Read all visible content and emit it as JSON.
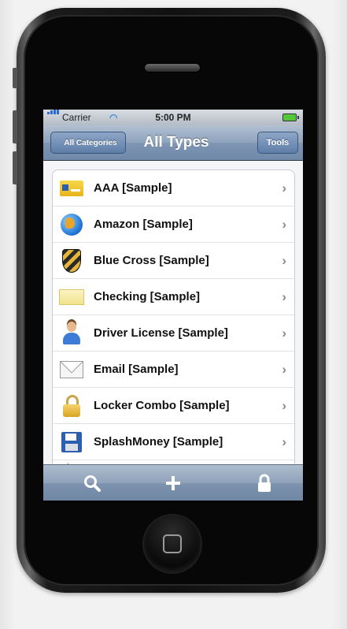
{
  "status_bar": {
    "carrier": "Carrier",
    "time": "5:00 PM"
  },
  "nav": {
    "back_label": "All Categories",
    "title": "All Types",
    "tools_label": "Tools"
  },
  "list": {
    "items": [
      {
        "label": "AAA [Sample]",
        "icon": "id-card-icon"
      },
      {
        "label": "Amazon [Sample]",
        "icon": "globe-icon"
      },
      {
        "label": "Blue Cross [Sample]",
        "icon": "shield-icon"
      },
      {
        "label": "Checking [Sample]",
        "icon": "check-icon"
      },
      {
        "label": "Driver License [Sample]",
        "icon": "person-icon"
      },
      {
        "label": "Email [Sample]",
        "icon": "mail-icon"
      },
      {
        "label": "Locker Combo [Sample]",
        "icon": "padlock-icon"
      },
      {
        "label": "SplashMoney [Sample]",
        "icon": "floppy-icon"
      }
    ],
    "chevron": "›"
  },
  "tab_bar": {
    "items": [
      {
        "name": "search-icon",
        "glyph": "⚲"
      },
      {
        "name": "add-icon",
        "glyph": "+"
      },
      {
        "name": "lock-icon",
        "glyph": "🔒"
      }
    ]
  },
  "colors": {
    "nav_blue": "#7f96b3",
    "tab_blue": "#7d93ae",
    "phone_body": "#111111"
  }
}
